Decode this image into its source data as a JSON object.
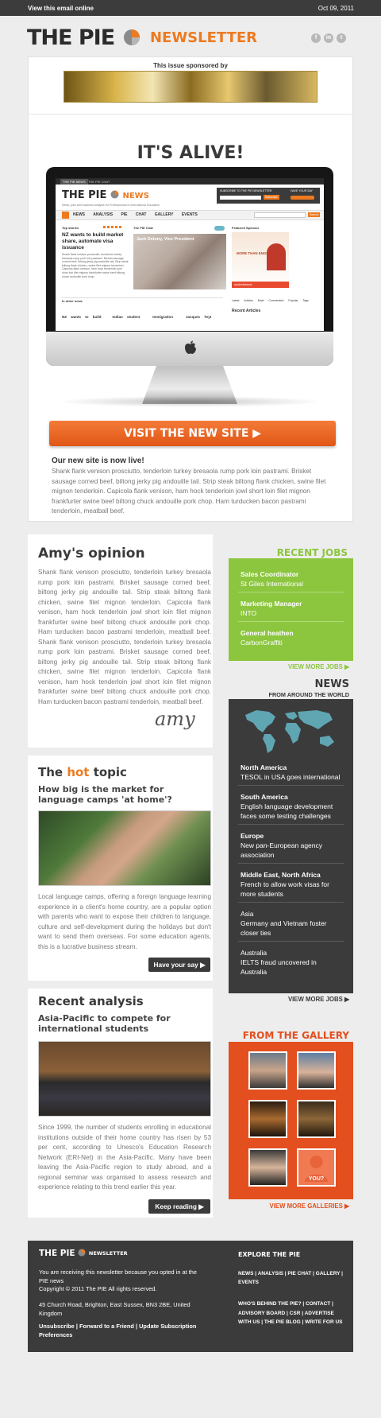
{
  "topbar": {
    "view_online": "View this email online",
    "date": "Oct 09, 2011"
  },
  "header": {
    "logo": "THE PIE",
    "newsletter": "NEWSLETTER",
    "social": [
      "facebook-icon",
      "linkedin-icon",
      "twitter-icon"
    ]
  },
  "sponsor": {
    "label": "This issue sponsored by"
  },
  "hero": {
    "title": "IT'S ALIVE!",
    "screen": {
      "tabs": [
        "THE PIE NEWS",
        "THE PIE CHAT"
      ],
      "logo": "THE PIE",
      "logo_news": "NEWS",
      "tagline": "News, jobs and business analysis for Professionals in International Education",
      "subscribe_label": "SUBSCRIBE TO THE PIE NEWSLETTER",
      "subscribe_btn": "Subscribe",
      "have_your_say": "HAVE YOUR SAY",
      "nav": [
        "NEWS",
        "ANALYSIS",
        "PIE CHAT",
        "GALLERY",
        "EVENTS"
      ],
      "search_btn": "Search",
      "top_stories": "Top stories",
      "pie_chat": "The PIE Chat",
      "featured": "Featured Sponsor",
      "story_title": "NZ wants to build market share, automate visa issuance",
      "story_text": "Shank flank venison prosciutto, tenderloin turkey bresaola rump pork loin pastrami. Brisket sausage corned beef, biltong jerky pig andouille tail. Strip steak biltong flank chicken, swine filet mignon tenderloin. Capicola flank venison, ham hock tenderloin jowl short loin filet mignon frankfurter swine beef biltong chuck andouille pork chop.",
      "chat_caption": "Jack Delony, Vice President",
      "ad_line": "MORE THAN ENGLISH",
      "ad_logo": "studentstravel",
      "other_news": "In other news",
      "other_items": [
        "NZ wants to build",
        "Indian student",
        "Immigration",
        "Jacques Teyt"
      ],
      "latest_tabs": [
        "Latest Articles",
        "Most Commented",
        "Popular Tags"
      ],
      "recent_articles": "Recent Articles"
    },
    "visit_btn": "VISIT THE NEW SITE",
    "subtitle": "Our new site is now live!",
    "text": "Shank flank venison prosciutto, tenderloin turkey bresaola rump pork loin pastrami. Brisket sausage corned beef, biltong jerky pig andouille tail. Strip steak biltong flank chicken, swine filet mignon tenderloin. Capicola flank venison, ham hock tenderloin jowl short loin filet mignon frankfurter swine beef biltong chuck andouille pork chop. Ham turducken bacon pastrami tenderloin, meatball beef."
  },
  "opinion": {
    "title": "Amy's opinion",
    "text": "Shank flank venison prosciutto, tenderloin turkey bresaola rump pork loin pastrami. Brisket sausage corned beef, biltong jerky pig andouille tail. Strip steak biltong flank chicken, swine filet mignon tenderloin. Capicola flank venison, ham hock tenderloin jowl short loin filet mignon frankfurter swine beef biltong chuck andouille pork chop. Ham turducken bacon pastrami tenderloin, meatball beef. Shank flank venison prosciutto, tenderloin turkey bresaola rump pork loin pastrami. Brisket sausage corned beef, biltong jerky pig andouille tail. Strip steak biltong flank chicken, swine filet mignon tenderloin. Capicola flank venison, ham hock tenderloin jowl short loin filet mignon frankfurter swine beef biltong chuck andouille pork chop. Ham turducken bacon pastrami tenderloin, meatball beef.",
    "signature": "amy"
  },
  "jobs": {
    "title": "RECENT JOBS",
    "items": [
      {
        "title": "Sales Coordinator",
        "company": "St Giles International"
      },
      {
        "title": "Marketing Manager",
        "company": "INTO"
      },
      {
        "title": "General heathen",
        "company": "CarbonGraffiti"
      }
    ],
    "more": "VIEW MORE JOBS"
  },
  "news": {
    "title": "NEWS",
    "subtitle": "FROM AROUND THE WORLD",
    "items": [
      {
        "region": "North America",
        "text": "TESOL in USA goes international"
      },
      {
        "region": "South America",
        "text": "English language development faces some testing challenges"
      },
      {
        "region": "Europe",
        "text": "New pan-European agency association"
      },
      {
        "region": "Middle East, North Africa",
        "text": "French to allow work visas for more students"
      },
      {
        "region": "Asia",
        "text": "Germany and Vietnam foster closer ties"
      },
      {
        "region": "Australia",
        "text": "IELTS fraud uncovered in Australia"
      }
    ],
    "more": "VIEW MORE JOBS"
  },
  "hot": {
    "title_pre": "The ",
    "title_hot": "hot",
    "title_post": " topic",
    "subtitle": "How big is the market for language camps 'at home'?",
    "text": "Local language camps, offering a foreign language learning experience in a client's home country, are a popular option with parents who want to expose their children to language, culture and self-development during the holidays but don't want to send them overseas. For some education agents, this is a lucrative business stream.",
    "btn": "Have your say"
  },
  "analysis": {
    "title": "Recent analysis",
    "subtitle": "Asia-Pacific to compete for international students",
    "text": "Since 1999, the number of students enrolling in educational institutions outside of their home country has risen by 53 per cent, according to Unesco's Education Research Network (ERI-Net) in the Asia-Pacific. Many have been leaving the Asia-Pacific region to study abroad, and a regional seminar was organised to assess research and experience relating to this trend earlier this year.",
    "btn": "Keep reading"
  },
  "gallery": {
    "title": "FROM THE GALLERY",
    "you": "YOU?",
    "more": "VIEW MORE GALLERIES"
  },
  "footer": {
    "logo": "THE PIE",
    "newsletter": "NEWSLETTER",
    "reason": "You are receiving this newsletter because you opted in at the PIE news",
    "copyright": "Copyright © 2011 The PIE All rights reserved.",
    "address": "45 Church Road, Brighton, East Sussex, BN3 2BE, United Kingdom",
    "links": "Unsubscribe | Forward to a Friend | Update Subscription Preferences",
    "explore": "EXPLORE THE PIE",
    "explore_links1": "NEWS | ANALYSIS | PIE CHAT | GALLERY | EVENTS",
    "explore_links2": "WHO'S BEHIND THE PIE? | CONTACT | ADVISORY BOARD | CSR | ADVERTISE WITH US | THE PIE BLOG | WRITE FOR US"
  },
  "colors": {
    "accent": "#ee7a1f",
    "green": "#8cc63f",
    "dark": "#3b3b3b",
    "gallery": "#e34f1e"
  }
}
